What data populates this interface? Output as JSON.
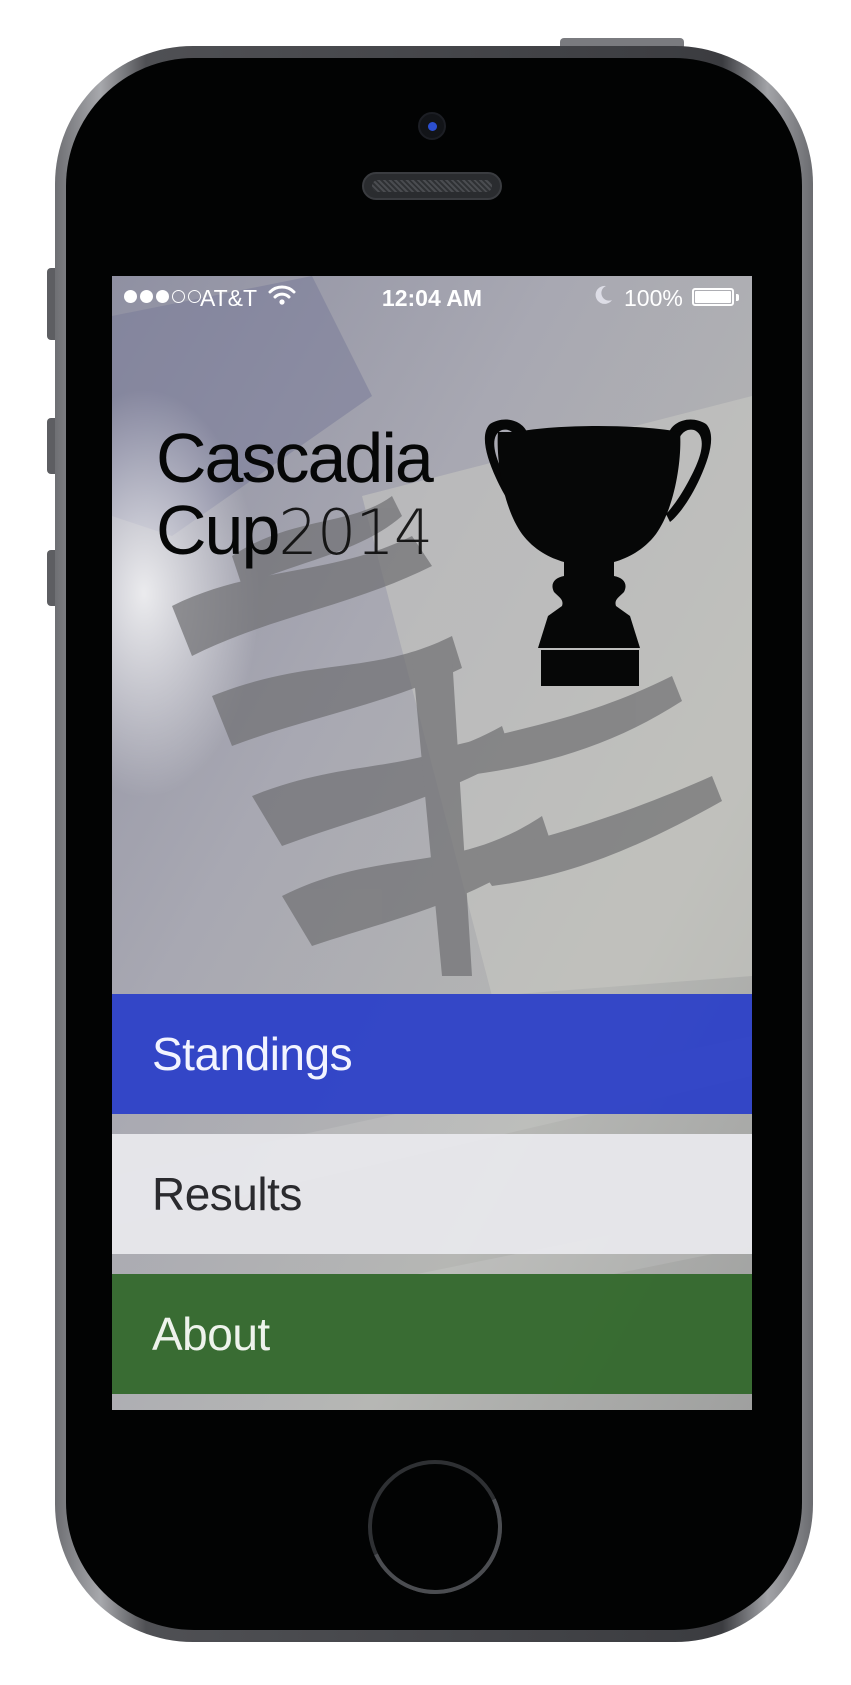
{
  "status_bar": {
    "carrier": "AT&T",
    "time": "12:04 AM",
    "battery_percent": "100%",
    "signal_bars": 3,
    "signal_total": 5
  },
  "logo": {
    "line1": "Cascadia",
    "line2": "Cup",
    "year": "2014"
  },
  "menu": {
    "standings": "Standings",
    "results": "Results",
    "about": "About"
  },
  "colors": {
    "standings": "#2c40c8",
    "results": "#e8e8ec",
    "about": "#366a30",
    "trophy": "#060707"
  },
  "icons": {
    "trophy": "trophy-icon",
    "wifi": "wifi-icon",
    "moon": "moon-icon",
    "battery": "battery-icon"
  }
}
